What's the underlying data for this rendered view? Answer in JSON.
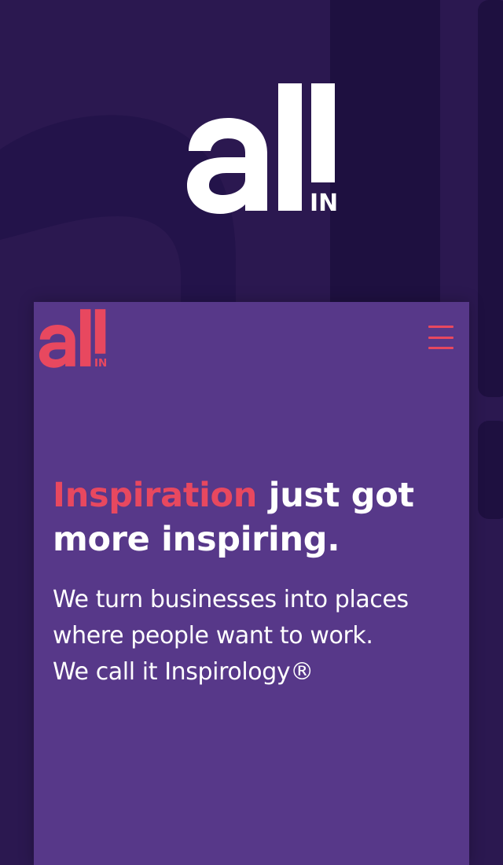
{
  "brand": {
    "logo_main": "all",
    "logo_sub": "IN",
    "logo_color_hero": "#ffffff",
    "logo_color_header": "#e8485f"
  },
  "colors": {
    "background": "#2b1850",
    "background_deco": "#221342",
    "panel": "#573889",
    "accent": "#e8485f",
    "text": "#ffffff"
  },
  "header": {
    "menu_icon": "hamburger-menu-icon"
  },
  "hero": {
    "headline_accent": "Inspiration",
    "headline_rest_line1": " just got",
    "headline_line2": "more inspiring.",
    "subtext_lines": [
      "We turn businesses into places",
      "where people want to work.",
      "We call it Inspirology®"
    ]
  }
}
